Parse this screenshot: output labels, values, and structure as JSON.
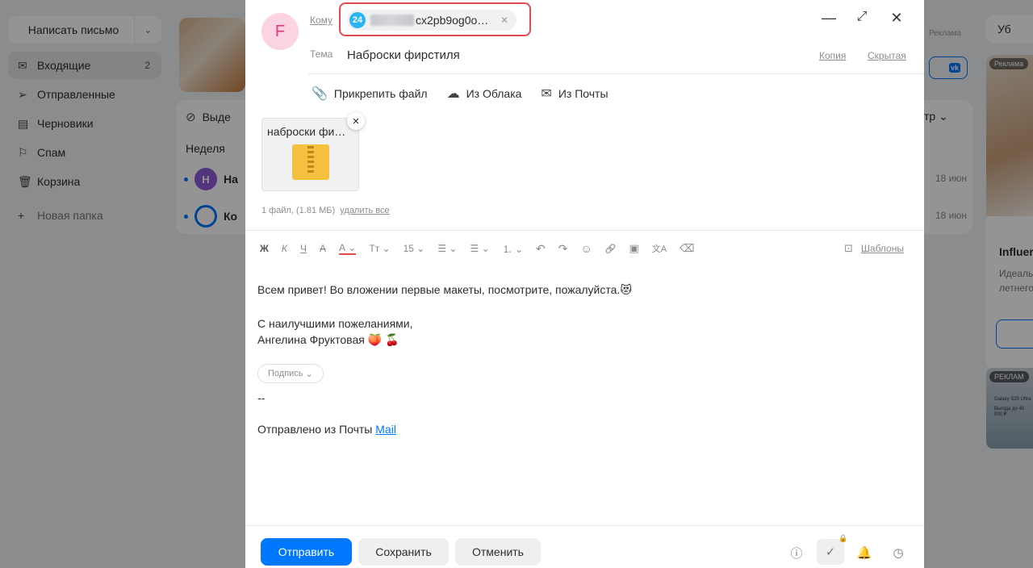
{
  "background": {
    "compose_button": {
      "label": "Написать письмо",
      "dropdown_icon": "chevron-down-icon"
    },
    "sidebar": {
      "items": [
        {
          "label": "Входящие",
          "icon": "inbox-icon",
          "count": "2",
          "active": true
        },
        {
          "label": "Отправленные",
          "icon": "send-icon",
          "count": ""
        },
        {
          "label": "Черновики",
          "icon": "draft-icon",
          "count": ""
        },
        {
          "label": "Спам",
          "icon": "spam-icon",
          "count": ""
        },
        {
          "label": "Корзина",
          "icon": "trash-icon",
          "count": ""
        }
      ],
      "new_folder": "Новая папка"
    },
    "list": {
      "select_label": "Выде",
      "group_label": "Неделя",
      "rows": [
        {
          "avatar": "H",
          "sender": "На",
          "date": "18 июн"
        },
        {
          "avatar": "",
          "sender": "Ко",
          "date": "18 июн"
        }
      ],
      "filter_label": "тр"
    },
    "right": {
      "ad_label": "Реклама",
      "button_label": "Уб",
      "ad_tag": "Реклама",
      "ad_title": "Influer",
      "ad_desc_1": "Идеаль",
      "ad_desc_2": "летнего",
      "ad2_tag": "РЕКЛАМ",
      "ad2_line1": "Galaxy S25 Ultra",
      "ad2_line2": "Выгода до 40 000 ₽"
    }
  },
  "compose": {
    "avatar_letter": "F",
    "to_label": "Кому",
    "recipient": {
      "badge": "24",
      "address": "cx2pb9og0o…"
    },
    "window_controls": {
      "minimize": "—",
      "expand": "⤢",
      "close": "✕"
    },
    "subject_label": "Тема",
    "subject": "Наброски фирстиля",
    "cc_label": "Копия",
    "bcc_label": "Скрытая",
    "attach_options": [
      {
        "label": "Прикрепить файл",
        "icon": "paperclip-icon"
      },
      {
        "label": "Из Облака",
        "icon": "cloud-icon"
      },
      {
        "label": "Из Почты",
        "icon": "mail-icon"
      }
    ],
    "attachment": {
      "name": "наброски фи…",
      "type": "zip"
    },
    "file_summary": "1 файл, (1.81 МБ)",
    "delete_all": "удалить все",
    "toolbar": {
      "bold": "Ж",
      "italic": "К",
      "underline": "Ч",
      "strike": "А",
      "text_color": "А ⌄",
      "font": "Тт ⌄",
      "size": "15 ⌄",
      "align": "☰ ⌄",
      "list": "☰ ⌄",
      "numbered": "⒈ ⌄",
      "undo": "↶",
      "redo": "↷",
      "emoji": "☺",
      "link": "🔗",
      "image": "▣",
      "translate": "文A",
      "clear": "⌫"
    },
    "templates_label": "Шаблоны",
    "body": {
      "line1": "Всем привет! Во вложении первые макеты, посмотрите, пожалуйста.",
      "line1_emoji": "😻",
      "line2": "С наилучшими пожеланиями,",
      "line3": "Ангелина Фруктовая",
      "line3_emoji": "🍑 🍒",
      "signature_button": "Подпись",
      "separator": "--",
      "sent_from": "Отправлено из Почты",
      "mail_link": "Mail"
    },
    "footer": {
      "send": "Отправить",
      "save": "Сохранить",
      "cancel": "Отменить",
      "icons": [
        "important-icon",
        "receipt-icon",
        "bell-icon",
        "clock-icon"
      ]
    }
  }
}
